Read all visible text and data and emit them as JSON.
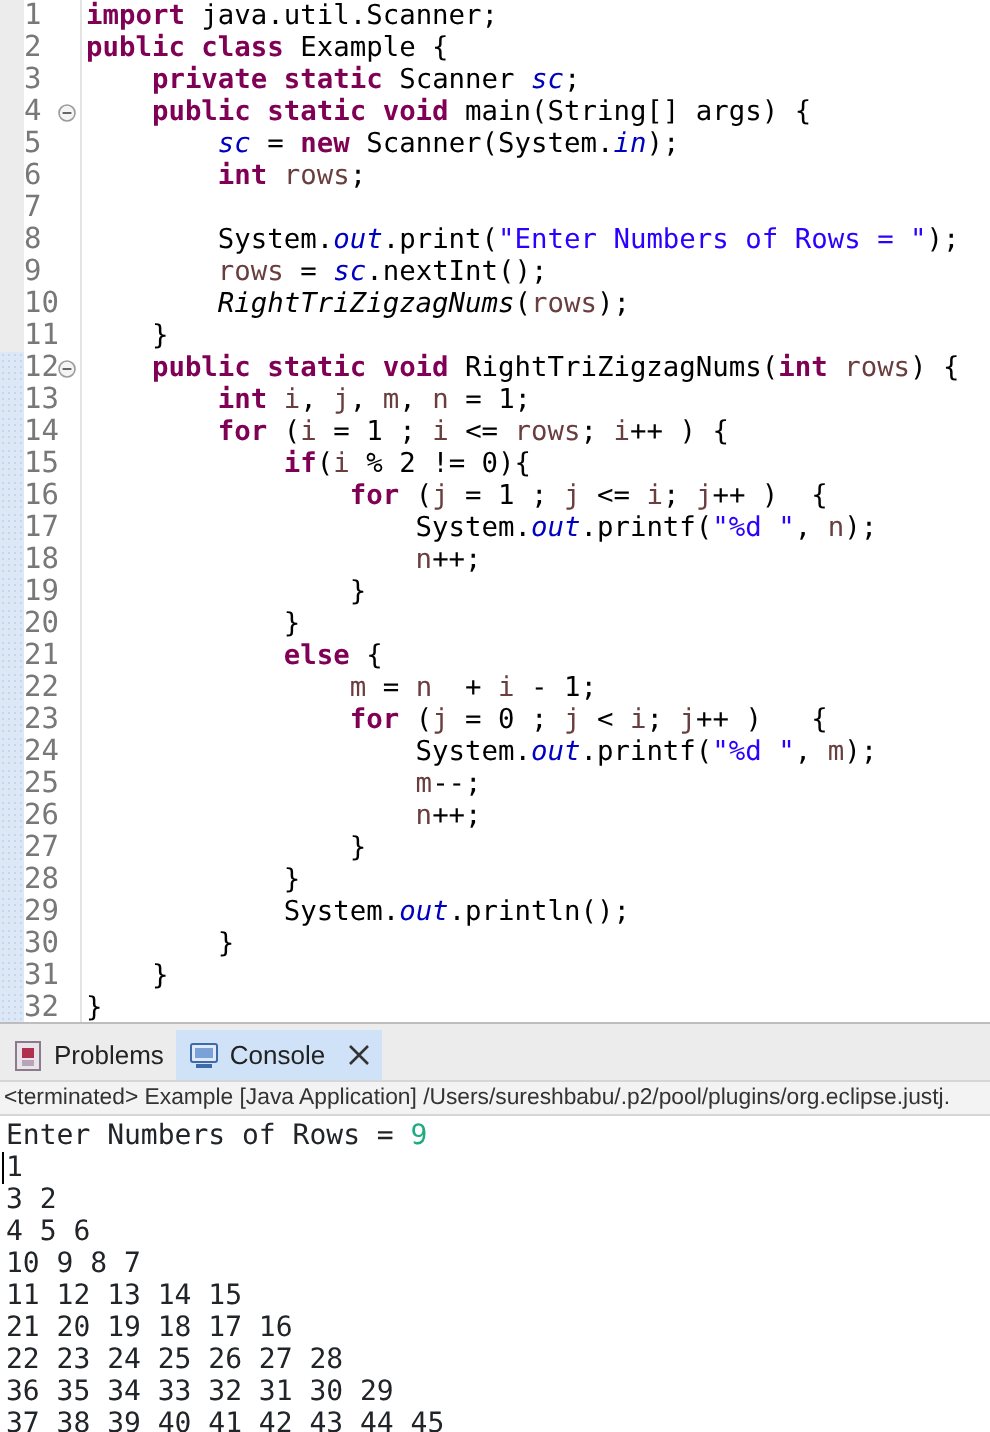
{
  "editor": {
    "lines": [
      {
        "number": "1",
        "scope": false,
        "tokens": [
          {
            "text": "import",
            "kind": "keyword"
          },
          {
            "text": " java.util.Scanner;",
            "kind": "plain"
          }
        ]
      },
      {
        "number": "2",
        "scope": false,
        "tokens": [
          {
            "text": "public class",
            "kind": "keyword"
          },
          {
            "text": " Example {",
            "kind": "plain"
          }
        ]
      },
      {
        "number": "3",
        "scope": false,
        "tokens": [
          {
            "text": "    private static",
            "kind": "keyword"
          },
          {
            "text": " Scanner ",
            "kind": "plain"
          },
          {
            "text": "sc",
            "kind": "field"
          },
          {
            "text": ";",
            "kind": "plain"
          }
        ]
      },
      {
        "number": "4",
        "scope": false,
        "foldable": true,
        "tokens": [
          {
            "text": "    public static void",
            "kind": "keyword"
          },
          {
            "text": " main(String[] args) {",
            "kind": "plain"
          }
        ]
      },
      {
        "number": "5",
        "scope": false,
        "tokens": [
          {
            "text": "        sc",
            "kind": "field"
          },
          {
            "text": " = ",
            "kind": "plain"
          },
          {
            "text": "new",
            "kind": "keyword"
          },
          {
            "text": " Scanner(System.",
            "kind": "plain"
          },
          {
            "text": "in",
            "kind": "field"
          },
          {
            "text": ");",
            "kind": "plain"
          }
        ]
      },
      {
        "number": "6",
        "scope": false,
        "tokens": [
          {
            "text": "        int",
            "kind": "keyword"
          },
          {
            "text": " rows",
            "kind": "local"
          },
          {
            "text": ";",
            "kind": "plain"
          }
        ]
      },
      {
        "number": "7",
        "scope": false
      },
      {
        "number": "8",
        "scope": false,
        "tokens": [
          {
            "text": "        System.",
            "kind": "plain"
          },
          {
            "text": "out",
            "kind": "field"
          },
          {
            "text": ".print(",
            "kind": "plain"
          },
          {
            "text": "\"Enter Numbers of Rows = \"",
            "kind": "string"
          },
          {
            "text": ");",
            "kind": "plain"
          }
        ]
      },
      {
        "number": "9",
        "scope": false,
        "tokens": [
          {
            "text": "        rows",
            "kind": "local"
          },
          {
            "text": " = ",
            "kind": "plain"
          },
          {
            "text": "sc",
            "kind": "field"
          },
          {
            "text": ".nextInt();",
            "kind": "plain"
          }
        ]
      },
      {
        "number": "10",
        "scope": false,
        "tokens": [
          {
            "text": "        RightTriZigzagNums",
            "kind": "static-call"
          },
          {
            "text": "(",
            "kind": "plain"
          },
          {
            "text": "rows",
            "kind": "local"
          },
          {
            "text": ");",
            "kind": "plain"
          }
        ]
      },
      {
        "number": "11",
        "scope": false,
        "tokens": [
          {
            "text": "    }",
            "kind": "plain"
          }
        ]
      },
      {
        "number": "12",
        "scope": true,
        "foldable": true,
        "tokens": [
          {
            "text": "    public static void",
            "kind": "keyword"
          },
          {
            "text": " RightTriZigzagNums(",
            "kind": "plain"
          },
          {
            "text": "int",
            "kind": "keyword"
          },
          {
            "text": " rows",
            "kind": "local"
          },
          {
            "text": ") {",
            "kind": "plain"
          }
        ]
      },
      {
        "number": "13",
        "scope": true,
        "tokens": [
          {
            "text": "        int",
            "kind": "keyword"
          },
          {
            "text": " i",
            "kind": "local"
          },
          {
            "text": ", ",
            "kind": "plain"
          },
          {
            "text": "j",
            "kind": "local"
          },
          {
            "text": ", ",
            "kind": "plain"
          },
          {
            "text": "m",
            "kind": "local"
          },
          {
            "text": ", ",
            "kind": "plain"
          },
          {
            "text": "n",
            "kind": "local"
          },
          {
            "text": " = 1;",
            "kind": "plain"
          }
        ]
      },
      {
        "number": "14",
        "scope": true,
        "tokens": [
          {
            "text": "        for",
            "kind": "keyword"
          },
          {
            "text": " (",
            "kind": "plain"
          },
          {
            "text": "i",
            "kind": "local"
          },
          {
            "text": " = 1 ; ",
            "kind": "plain"
          },
          {
            "text": "i",
            "kind": "local"
          },
          {
            "text": " <= ",
            "kind": "plain"
          },
          {
            "text": "rows",
            "kind": "local"
          },
          {
            "text": "; ",
            "kind": "plain"
          },
          {
            "text": "i",
            "kind": "local"
          },
          {
            "text": "++ ) {",
            "kind": "plain"
          }
        ]
      },
      {
        "number": "15",
        "scope": true,
        "tokens": [
          {
            "text": "            if",
            "kind": "keyword"
          },
          {
            "text": "(",
            "kind": "plain"
          },
          {
            "text": "i",
            "kind": "local"
          },
          {
            "text": " % 2 != 0){",
            "kind": "plain"
          }
        ]
      },
      {
        "number": "16",
        "scope": true,
        "tokens": [
          {
            "text": "                for",
            "kind": "keyword"
          },
          {
            "text": " (",
            "kind": "plain"
          },
          {
            "text": "j",
            "kind": "local"
          },
          {
            "text": " = 1 ; ",
            "kind": "plain"
          },
          {
            "text": "j",
            "kind": "local"
          },
          {
            "text": " <= ",
            "kind": "plain"
          },
          {
            "text": "i",
            "kind": "local"
          },
          {
            "text": "; ",
            "kind": "plain"
          },
          {
            "text": "j",
            "kind": "local"
          },
          {
            "text": "++ )  {",
            "kind": "plain"
          }
        ]
      },
      {
        "number": "17",
        "scope": true,
        "tokens": [
          {
            "text": "                    System.",
            "kind": "plain"
          },
          {
            "text": "out",
            "kind": "field"
          },
          {
            "text": ".printf(",
            "kind": "plain"
          },
          {
            "text": "\"%d \"",
            "kind": "string"
          },
          {
            "text": ", ",
            "kind": "plain"
          },
          {
            "text": "n",
            "kind": "local"
          },
          {
            "text": ");",
            "kind": "plain"
          }
        ]
      },
      {
        "number": "18",
        "scope": true,
        "tokens": [
          {
            "text": "                    n",
            "kind": "local"
          },
          {
            "text": "++;",
            "kind": "plain"
          }
        ]
      },
      {
        "number": "19",
        "scope": true,
        "tokens": [
          {
            "text": "                }",
            "kind": "plain"
          }
        ]
      },
      {
        "number": "20",
        "scope": true,
        "tokens": [
          {
            "text": "            }",
            "kind": "plain"
          }
        ]
      },
      {
        "number": "21",
        "scope": true,
        "tokens": [
          {
            "text": "            else",
            "kind": "keyword"
          },
          {
            "text": " {",
            "kind": "plain"
          }
        ]
      },
      {
        "number": "22",
        "scope": true,
        "tokens": [
          {
            "text": "                m",
            "kind": "local"
          },
          {
            "text": " = ",
            "kind": "plain"
          },
          {
            "text": "n",
            "kind": "local"
          },
          {
            "text": "  + ",
            "kind": "plain"
          },
          {
            "text": "i",
            "kind": "local"
          },
          {
            "text": " - 1;",
            "kind": "plain"
          }
        ]
      },
      {
        "number": "23",
        "scope": true,
        "tokens": [
          {
            "text": "                for",
            "kind": "keyword"
          },
          {
            "text": " (",
            "kind": "plain"
          },
          {
            "text": "j",
            "kind": "local"
          },
          {
            "text": " = 0 ; ",
            "kind": "plain"
          },
          {
            "text": "j",
            "kind": "local"
          },
          {
            "text": " < ",
            "kind": "plain"
          },
          {
            "text": "i",
            "kind": "local"
          },
          {
            "text": "; ",
            "kind": "plain"
          },
          {
            "text": "j",
            "kind": "local"
          },
          {
            "text": "++ )   {",
            "kind": "plain"
          }
        ]
      },
      {
        "number": "24",
        "scope": true,
        "tokens": [
          {
            "text": "                    System.",
            "kind": "plain"
          },
          {
            "text": "out",
            "kind": "field"
          },
          {
            "text": ".printf(",
            "kind": "plain"
          },
          {
            "text": "\"%d \"",
            "kind": "string"
          },
          {
            "text": ", ",
            "kind": "plain"
          },
          {
            "text": "m",
            "kind": "local"
          },
          {
            "text": ");",
            "kind": "plain"
          }
        ]
      },
      {
        "number": "25",
        "scope": true,
        "tokens": [
          {
            "text": "                    m",
            "kind": "local"
          },
          {
            "text": "--;",
            "kind": "plain"
          }
        ]
      },
      {
        "number": "26",
        "scope": true,
        "tokens": [
          {
            "text": "                    n",
            "kind": "local"
          },
          {
            "text": "++;",
            "kind": "plain"
          }
        ]
      },
      {
        "number": "27",
        "scope": true,
        "tokens": [
          {
            "text": "                }",
            "kind": "plain"
          }
        ]
      },
      {
        "number": "28",
        "scope": true,
        "tokens": [
          {
            "text": "            }",
            "kind": "plain"
          }
        ]
      },
      {
        "number": "29",
        "scope": true,
        "tokens": [
          {
            "text": "            System.",
            "kind": "plain"
          },
          {
            "text": "out",
            "kind": "field"
          },
          {
            "text": ".println();",
            "kind": "plain"
          }
        ]
      },
      {
        "number": "30",
        "scope": true,
        "tokens": [
          {
            "text": "        }",
            "kind": "plain"
          }
        ]
      },
      {
        "number": "31",
        "scope": true,
        "tokens": [
          {
            "text": "    }",
            "kind": "plain"
          }
        ]
      },
      {
        "number": "32",
        "scope": true,
        "tokens": [
          {
            "text": "}",
            "kind": "plain"
          }
        ]
      }
    ]
  },
  "panel": {
    "tabs": [
      {
        "label": "Problems",
        "kind": "problems",
        "selected": false,
        "closable": false
      },
      {
        "label": "Console",
        "kind": "console",
        "selected": true,
        "closable": true
      }
    ],
    "status": "<terminated> Example [Java Application] /Users/sureshbabu/.p2/pool/plugins/org.eclipse.justj.",
    "prompt": "Enter Numbers of Rows = ",
    "input": "9",
    "output": [
      "1",
      "3 2",
      "4 5 6",
      "10 9 8 7",
      "11 12 13 14 15",
      "21 20 19 18 17 16",
      "22 23 24 25 26 27 28",
      "36 35 34 33 32 31 30 29",
      "37 38 39 40 41 42 43 44 45"
    ]
  }
}
